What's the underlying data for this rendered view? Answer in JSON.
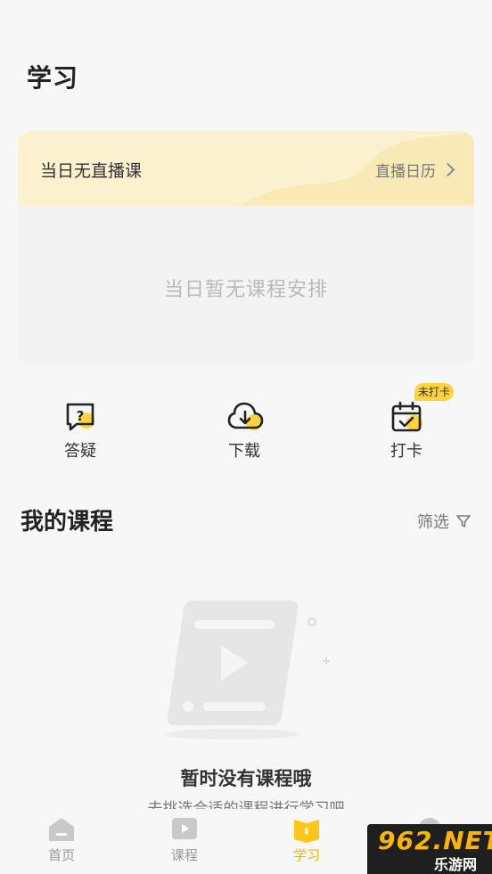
{
  "header": {
    "title": "学习"
  },
  "live": {
    "title": "当日无直播课",
    "calendar_link": "直播日历",
    "empty_text": "当日暂无课程安排"
  },
  "actions": [
    {
      "label": "答疑",
      "icon": "question-bubble-icon"
    },
    {
      "label": "下载",
      "icon": "cloud-download-icon"
    },
    {
      "label": "打卡",
      "icon": "calendar-check-icon",
      "badge": "未打卡"
    }
  ],
  "courses": {
    "title": "我的课程",
    "filter_label": "筛选",
    "empty_title": "暂时没有课程哦",
    "empty_subtitle": "去挑选合适的课程进行学习吧"
  },
  "tabbar": [
    {
      "label": "首页",
      "icon": "home-icon",
      "active": false
    },
    {
      "label": "课程",
      "icon": "play-icon",
      "active": false
    },
    {
      "label": "学习",
      "icon": "book-icon",
      "active": true
    },
    {
      "label": "",
      "icon": "profile-icon",
      "active": false
    }
  ],
  "watermark": {
    "big": "962.NET",
    "small": "乐游网"
  },
  "colors": {
    "accent": "#ffd43b",
    "active_tab": "#f5b800",
    "header_bg": "#fbf1cf"
  }
}
